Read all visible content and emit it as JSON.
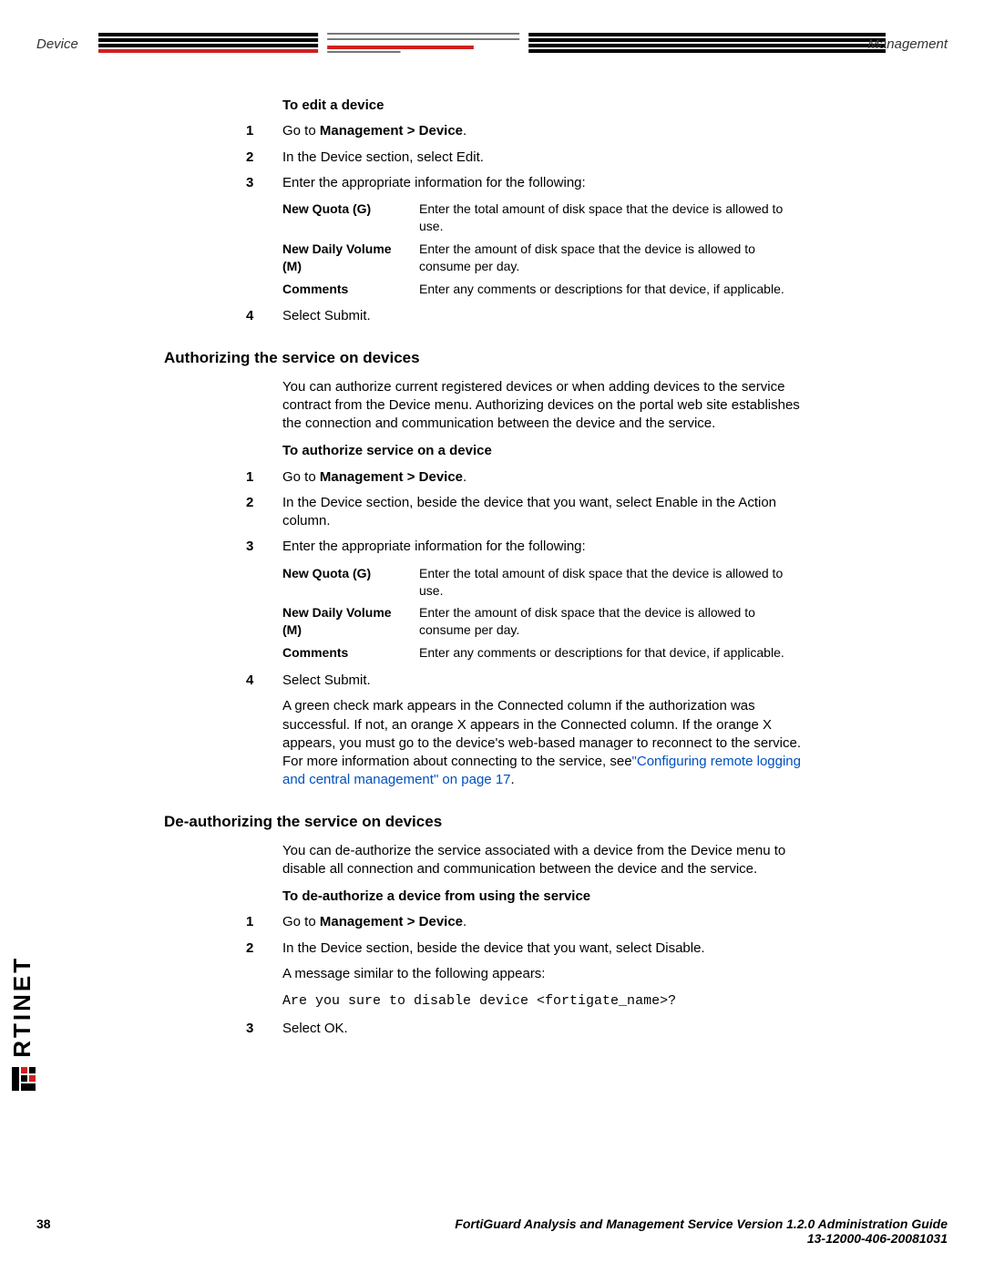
{
  "header": {
    "left": "Device",
    "right": "Management"
  },
  "proc1": {
    "title": "To edit a device",
    "steps": {
      "s1_pre": "Go to ",
      "s1_bold": "Management > Device",
      "s1_post": ".",
      "s2": "In the Device section, select Edit.",
      "s3": "Enter the appropriate information for the following:",
      "s4": "Select Submit."
    },
    "fields": {
      "f1_name": "New Quota (G)",
      "f1_desc": "Enter the total amount of disk space that the device is allowed to use.",
      "f2_name": "New Daily Volume (M)",
      "f2_desc": "Enter the amount of disk space that the device is allowed to consume per day.",
      "f3_name": "Comments",
      "f3_desc": "Enter any comments or descriptions for that device, if applicable."
    }
  },
  "section1": {
    "heading": "Authorizing the service on devices",
    "intro": "You can authorize current registered devices or when adding devices to the service contract from the Device menu. Authorizing devices on the portal web site establishes the connection and communication between the device and the service.",
    "proc_title": "To authorize service on a device",
    "steps": {
      "s1_pre": "Go to ",
      "s1_bold": "Management > Device",
      "s1_post": ".",
      "s2": "In the Device section, beside the device that you want, select Enable in the Action column.",
      "s3": "Enter the appropriate information for the following:",
      "s4": "Select Submit.",
      "s4_para_pre": "A green check mark appears in the Connected column if the authorization was successful. If not, an orange X appears in the Connected column. If the orange X appears, you must go to the device's web-based manager to reconnect to the service. For more information about connecting to the service, see",
      "s4_link": "\"Configuring remote logging and central management\" on page 17",
      "s4_para_post": "."
    },
    "fields": {
      "f1_name": "New Quota (G)",
      "f1_desc": "Enter the total amount of disk space that the device is allowed to use.",
      "f2_name": "New Daily Volume (M)",
      "f2_desc": "Enter the amount of disk space that the device is allowed to consume per day.",
      "f3_name": "Comments",
      "f3_desc": "Enter any comments or descriptions for that device, if applicable."
    }
  },
  "section2": {
    "heading": "De-authorizing the service on devices",
    "intro": "You can de-authorize the service associated with a device from the Device menu to disable all connection and communication between the device and the service.",
    "proc_title": "To de-authorize a device from using the service",
    "steps": {
      "s1_pre": "Go to ",
      "s1_bold": "Management > Device",
      "s1_post": ".",
      "s2": "In the Device section, beside the device that you want, select Disable.",
      "s2_para": "A message similar to the following appears:",
      "s2_code": "Are you sure to disable device <fortigate_name>?",
      "s3": "Select OK."
    }
  },
  "logo": {
    "text_black": "RTINET",
    "icon_hint": "F-shape-red-black"
  },
  "footer": {
    "page": "38",
    "line1": "FortiGuard Analysis and Management Service Version 1.2.0 Administration Guide",
    "line2": "13-12000-406-20081031"
  },
  "nums": {
    "n1": "1",
    "n2": "2",
    "n3": "3",
    "n4": "4"
  }
}
